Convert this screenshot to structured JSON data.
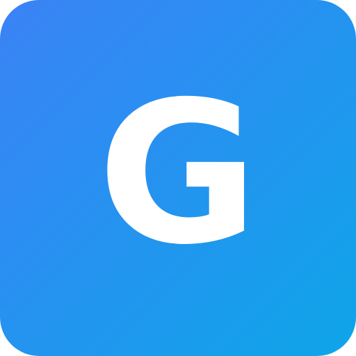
{
  "icon": {
    "letter": "G",
    "gradient_start": "#3b82f6",
    "gradient_end": "#0ea5e9",
    "text_color": "#ffffff"
  }
}
